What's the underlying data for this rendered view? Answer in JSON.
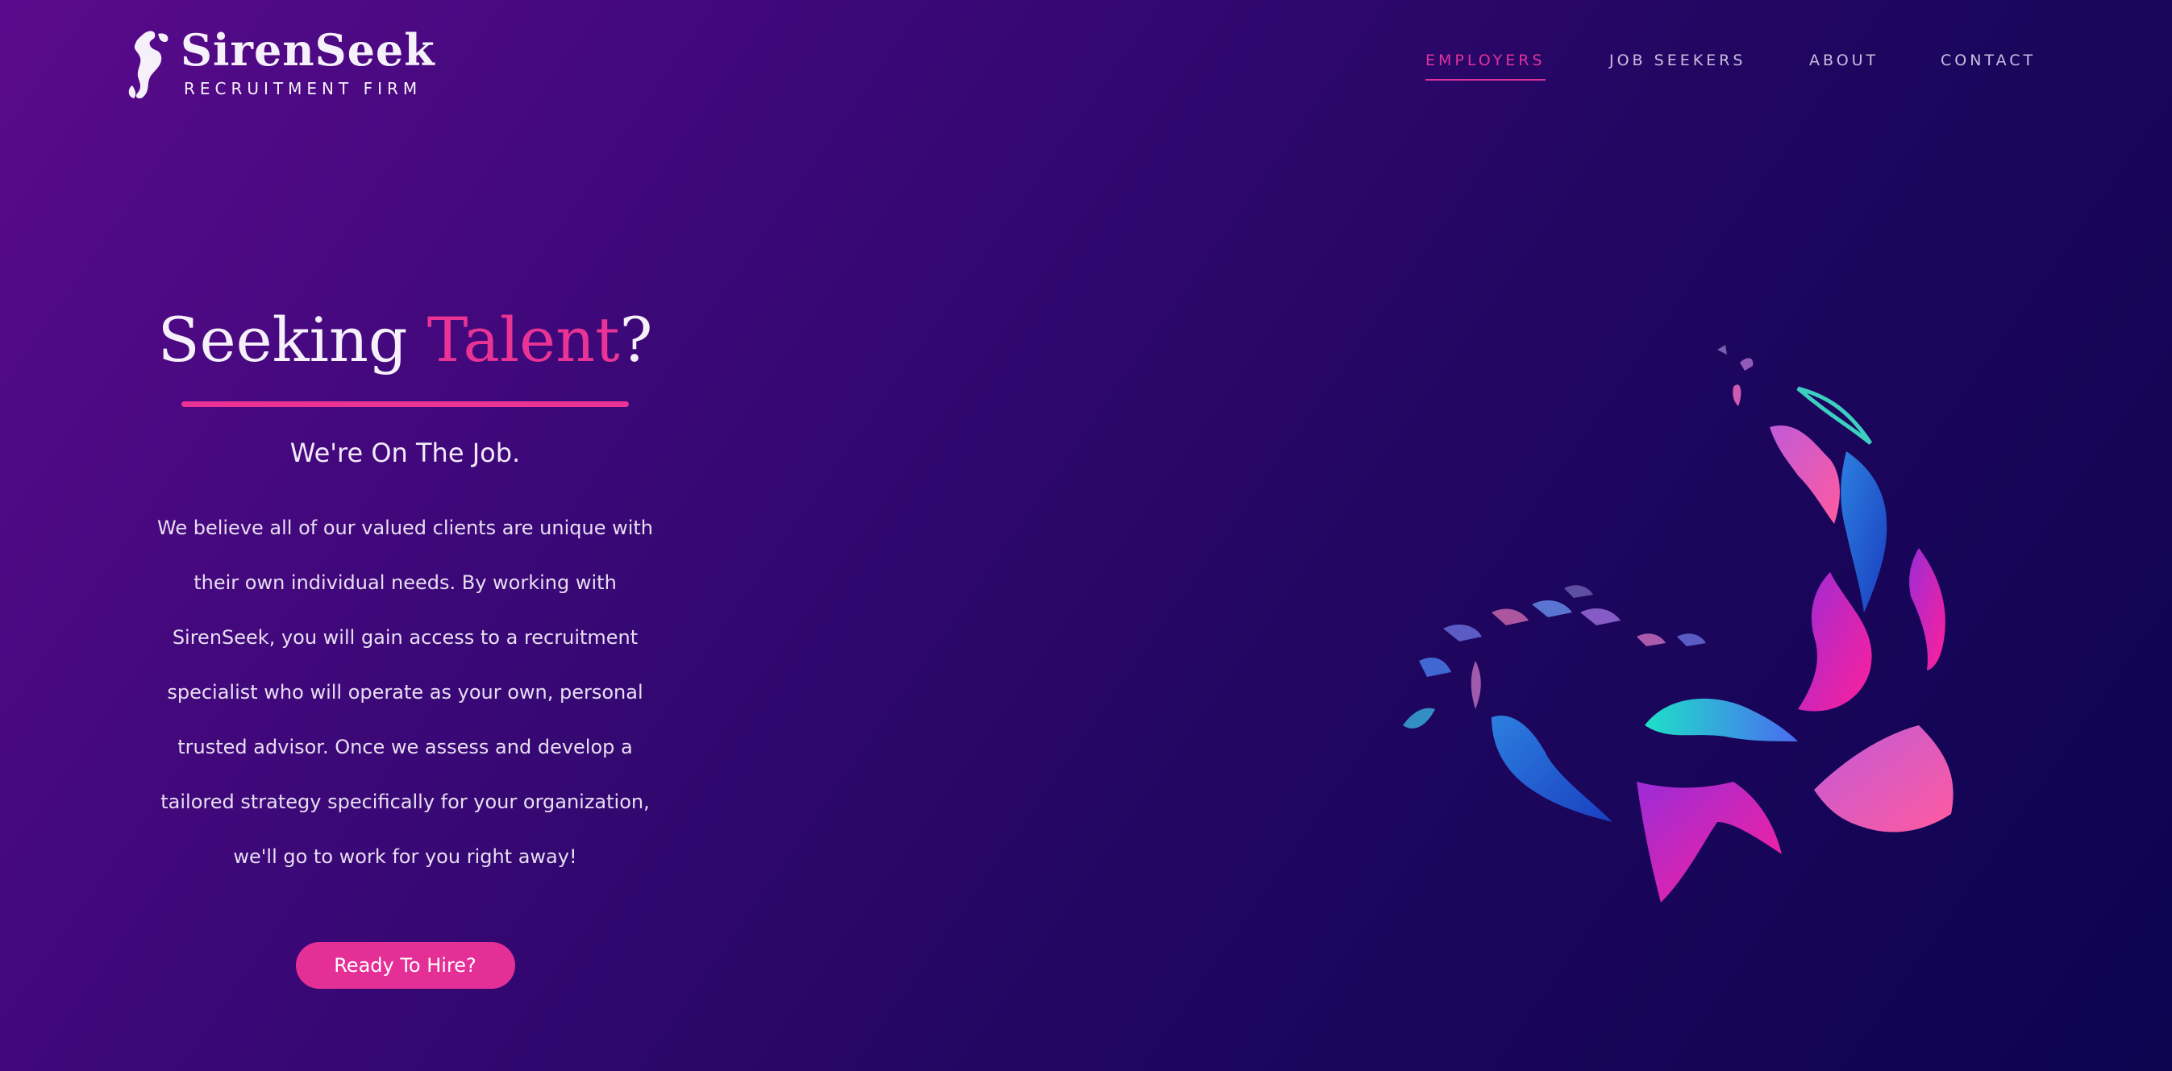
{
  "brand": {
    "name": "SirenSeek",
    "tagline": "RECRUITMENT FIRM"
  },
  "nav": {
    "items": [
      {
        "label": "EMPLOYERS",
        "active": true
      },
      {
        "label": "JOB SEEKERS",
        "active": false
      },
      {
        "label": "ABOUT",
        "active": false
      },
      {
        "label": "CONTACT",
        "active": false
      }
    ]
  },
  "hero": {
    "title_part1": "Seeking ",
    "title_accent": "Talent",
    "title_part2": "?",
    "subtitle": "We're On The Job.",
    "body": "We believe all of our valued clients are unique with their own individual needs. By working with SirenSeek, you will gain access to a recruitment specialist who will operate as your own, personal trusted advisor. Once we assess and develop a tailored strategy specifically for your organization, we'll go to work for you right away!",
    "cta_label": "Ready To Hire?"
  },
  "colors": {
    "accent": "#ea3394",
    "nav_text": "#c9bde0"
  },
  "illustration": {
    "icon": "school-of-fish-illustration"
  }
}
